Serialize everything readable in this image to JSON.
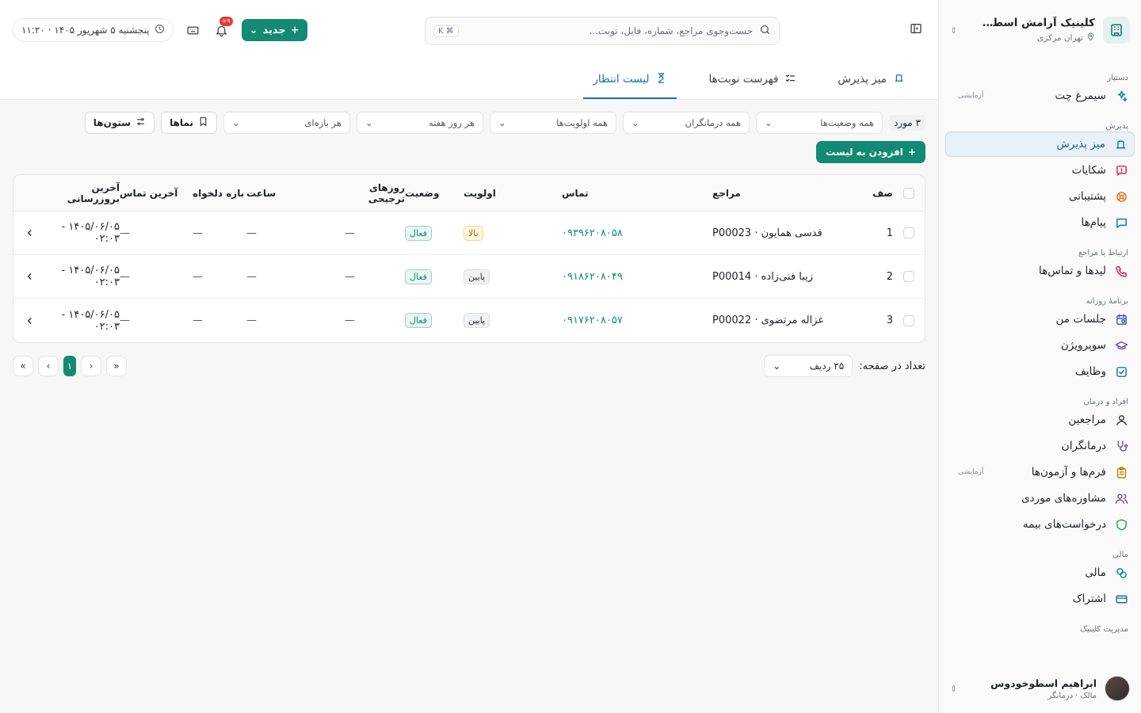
{
  "sidebar": {
    "clinic_name": "کلینیک آرامش اسطوخو...",
    "clinic_location": "تهران مرکزی",
    "groups": [
      {
        "title": "دستیار",
        "items": [
          {
            "label": "سیمرغ چت",
            "tag": "آزمایشی",
            "icon": "sparkles-icon"
          }
        ]
      },
      {
        "title": "پذیرش",
        "items": [
          {
            "label": "میز پذیرش",
            "icon": "desk-bell-icon",
            "active": true
          },
          {
            "label": "شکایات",
            "icon": "alert-message-icon"
          },
          {
            "label": "پشتیبانی",
            "icon": "lifebuoy-icon"
          },
          {
            "label": "پیام‌ها",
            "icon": "message-icon"
          }
        ]
      },
      {
        "title": "ارتباط با مراجع",
        "items": [
          {
            "label": "لیدها و تماس‌ها",
            "icon": "phone-call-icon"
          }
        ]
      },
      {
        "title": "برنامهٔ روزانه",
        "items": [
          {
            "label": "جلسات من",
            "icon": "calendar-clock-icon"
          },
          {
            "label": "سوپرویژن",
            "icon": "graduation-cap-icon"
          },
          {
            "label": "وظایف",
            "icon": "checkbox-icon"
          }
        ]
      },
      {
        "title": "افراد و درمان",
        "items": [
          {
            "label": "مراجعین",
            "icon": "user-icon"
          },
          {
            "label": "درمانگران",
            "icon": "stethoscope-icon"
          },
          {
            "label": "فرم‌ها و آزمون‌ها",
            "icon": "clipboard-icon",
            "tag": "آزمایشی"
          },
          {
            "label": "مشاوره‌های موردی",
            "icon": "users-icon"
          },
          {
            "label": "درخواست‌های بیمه",
            "icon": "shield-icon"
          }
        ]
      },
      {
        "title": "مالی",
        "items": [
          {
            "label": "مالی",
            "icon": "coins-icon"
          },
          {
            "label": "اشتراک",
            "icon": "credit-card-icon"
          }
        ]
      },
      {
        "title": "مدیریت کلینیک",
        "items": []
      }
    ],
    "user_name": "ابراهیم اسطوخودوس",
    "user_role": "مالک · درمانگر"
  },
  "topbar": {
    "search_placeholder": "جست‌وجوی مراجع، شماره، فایل، نوبت...",
    "search_shortcut": "⌘ K",
    "date": "پنجشنبه ۵ شهریور ۱۴۰۵ · ۱۱:۲۰",
    "notif_badge": "۹+",
    "new_label": "جدید"
  },
  "tabs": [
    {
      "label": "میز پذیرش",
      "icon": "desk-bell-icon"
    },
    {
      "label": "فهرست نوبت‌ها",
      "icon": "list-check-icon"
    },
    {
      "label": "لیست انتظار",
      "icon": "hourglass-icon",
      "active": true
    }
  ],
  "filters": {
    "count": "۳ مورد",
    "status": "همه وضعیت‌ها",
    "therapists": "همه درمانگران",
    "priorities": "همه اولویت‌ها",
    "weekdays": "هر روز هفته",
    "range": "هر بازه‌ای",
    "views": "نماها",
    "columns": "ستون‌ها",
    "add_to_list": "افزودن به لیست"
  },
  "table": {
    "headers": {
      "queue": "صف",
      "client": "مراجع",
      "contact": "تماس",
      "priority": "اولویت",
      "status": "وضعیت",
      "days": "روزهای ترجیحی",
      "time": "ساعت",
      "range": "بازه دلخواه",
      "last_contact": "آخرین تماس",
      "updated": "آخرین بروزرسانی"
    },
    "rows": [
      {
        "queue": "1",
        "client": "قدسی همایون · P00023",
        "contact": "۰۹۳۹۶۲۰۸۰۵۸",
        "priority": "بالا",
        "priority_level": "high",
        "status": "فعال",
        "days": "—",
        "time": "—",
        "range": "—",
        "last_contact": "—",
        "updated": "۱۴۰۵/۰۶/۰۵ - ۰۲:۰۳"
      },
      {
        "queue": "2",
        "client": "زیبا فنی‌زاده · P00014",
        "contact": "۰۹۱۸۶۲۰۸۰۴۹",
        "priority": "پایین",
        "priority_level": "low",
        "status": "فعال",
        "days": "—",
        "time": "—",
        "range": "—",
        "last_contact": "—",
        "updated": "۱۴۰۵/۰۶/۰۵ - ۰۲:۰۳"
      },
      {
        "queue": "3",
        "client": "غزاله مرتضوی · P00022",
        "contact": "۰۹۱۷۶۲۰۸۰۵۷",
        "priority": "پایین",
        "priority_level": "low",
        "status": "فعال",
        "days": "—",
        "time": "—",
        "range": "—",
        "last_contact": "—",
        "updated": "۱۴۰۵/۰۶/۰۵ - ۰۲:۰۳"
      }
    ]
  },
  "pagination": {
    "rows_per_page_label": "تعداد در صفحه:",
    "rows_per_page_value": "۲۵ ردیف",
    "current_page": "۱"
  },
  "colors": {
    "accent": "#138a73",
    "active_nav": "#1b6fa8"
  }
}
